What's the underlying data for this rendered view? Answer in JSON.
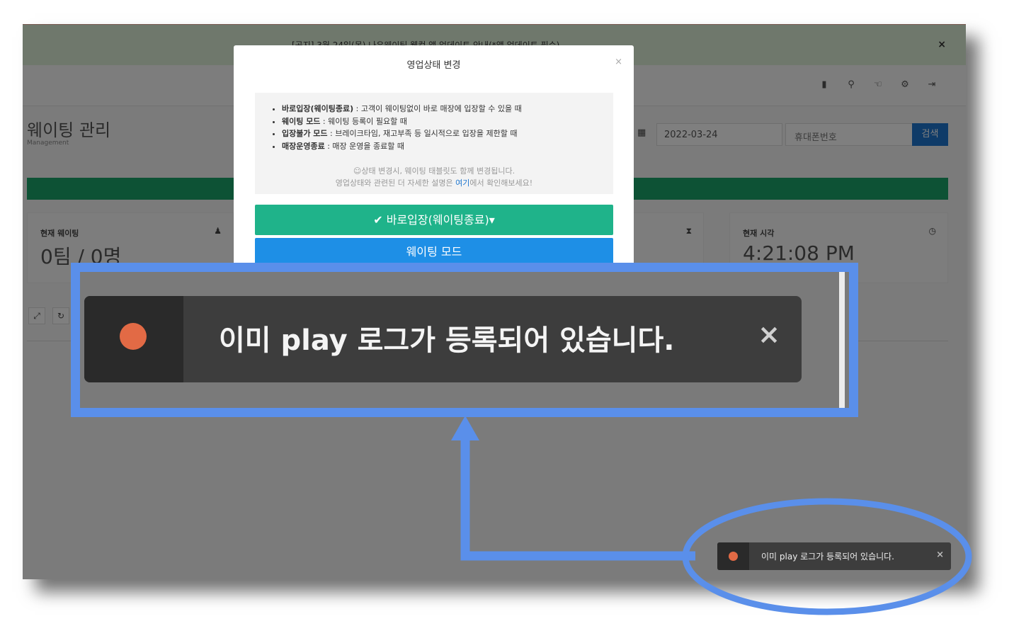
{
  "notice": {
    "text": "[공지] 3월 24일(목) 나우웨이팅 웹컴 앱 업데이트 안내(*앱 업데이트 필수)",
    "close": "×"
  },
  "header": {
    "title": "웨이팅 관리",
    "subtitle": "Management",
    "date_value": "2022-03-24",
    "phone_placeholder": "휴대폰번호",
    "search_label": "검색"
  },
  "stats": [
    {
      "label": "현재 웨이팅",
      "value": "0팀 / 0명",
      "icon": "users-icon"
    },
    {
      "label": "현재 시각",
      "value": "4:21:08 PM",
      "icon": "clock-icon"
    }
  ],
  "modal": {
    "title": "영업상태 변경",
    "close": "×",
    "items": [
      {
        "term": "바로입장(웨이팅종료)",
        "desc": " : 고객이 웨이팅없이 바로 매장에 입장할 수 있을 때"
      },
      {
        "term": "웨이팅 모드",
        "desc": " : 웨이팅 등록이 필요할 때"
      },
      {
        "term": "입장불가 모드",
        "desc": " : 브레이크타임, 재고부족 등 일시적으로 입장을 제한할 때"
      },
      {
        "term": "매장운영종료",
        "desc": " : 매장 운영을 종료할 때"
      }
    ],
    "hint1": "☺상태 변경시, 웨이팅 태블릿도 함께 변경됩니다.",
    "hint2_pre": "영업상태와 관련된 더 자세한 설명은 ",
    "hint2_link": "여기",
    "hint2_post": "에서 확인해보세요!",
    "btn_enter": "✔ 바로입장(웨이팅종료)▾",
    "btn_waiting": "웨이팅 모드"
  },
  "toast": {
    "message": "이미 play 로그가 등록되어 있습니다.",
    "close": "×"
  },
  "colors": {
    "callout": "#5a8fea",
    "toast_dot": "#e26a45",
    "enter_button": "#1fb38a",
    "waiting_button": "#1e8fe6",
    "search_button": "#1f77d0"
  }
}
